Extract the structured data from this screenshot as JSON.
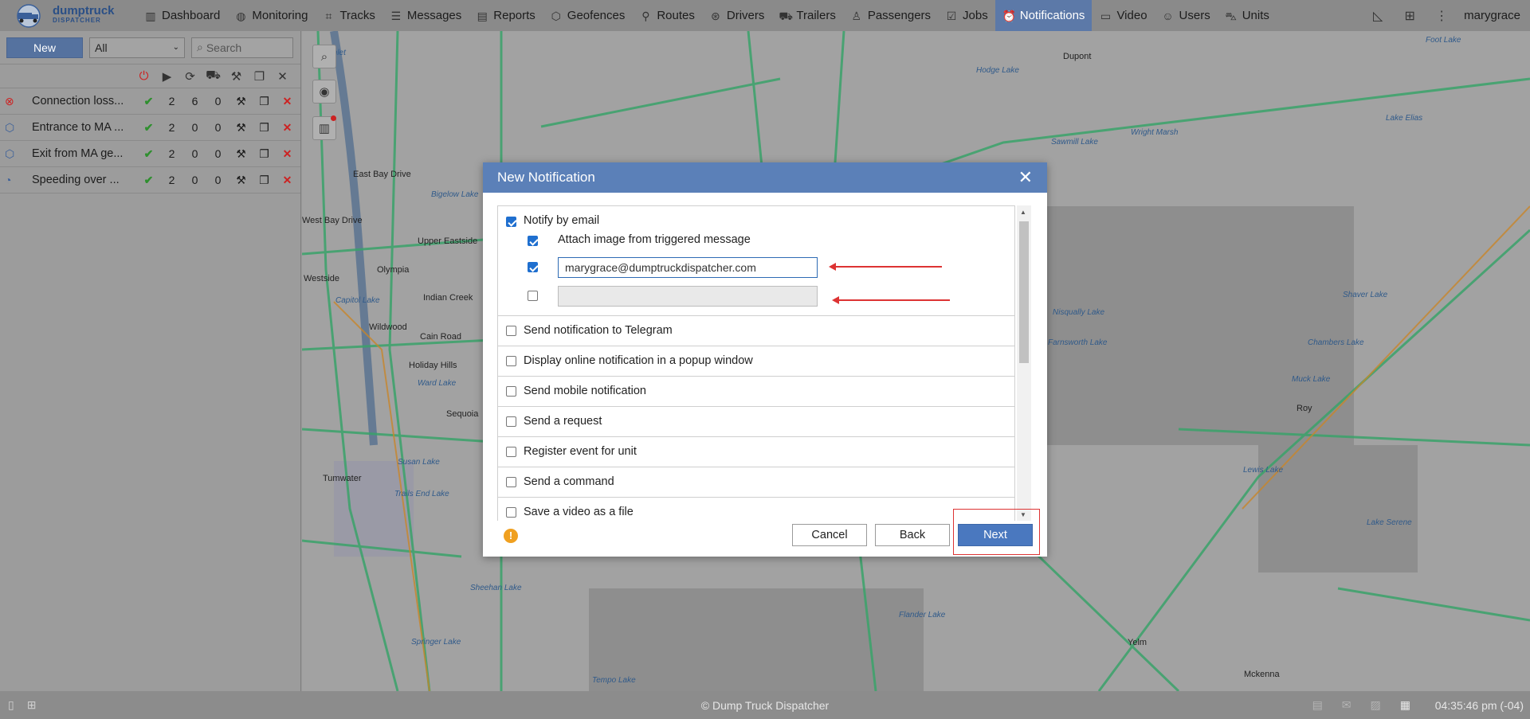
{
  "topbar": {
    "brand_line1": "dumptruck",
    "brand_line2": "DISPATCHER",
    "nav": [
      {
        "label": "Dashboard",
        "icon": "bar-chart-icon"
      },
      {
        "label": "Monitoring",
        "icon": "globe-icon"
      },
      {
        "label": "Tracks",
        "icon": "tracks-icon"
      },
      {
        "label": "Messages",
        "icon": "messages-icon"
      },
      {
        "label": "Reports",
        "icon": "reports-icon"
      },
      {
        "label": "Geofences",
        "icon": "geofence-icon"
      },
      {
        "label": "Routes",
        "icon": "routes-icon"
      },
      {
        "label": "Drivers",
        "icon": "steering-wheel-icon"
      },
      {
        "label": "Trailers",
        "icon": "trailer-icon"
      },
      {
        "label": "Passengers",
        "icon": "passenger-icon"
      },
      {
        "label": "Jobs",
        "icon": "jobs-icon"
      },
      {
        "label": "Notifications",
        "icon": "alarm-clock-icon",
        "active": true
      },
      {
        "label": "Video",
        "icon": "video-icon"
      },
      {
        "label": "Users",
        "icon": "user-icon"
      },
      {
        "label": "Units",
        "icon": "truck-icon"
      }
    ],
    "username": "marygrace"
  },
  "leftpanel": {
    "new_label": "New",
    "filter_value": "All",
    "search_placeholder": "Search",
    "rows": [
      {
        "name": "Connection loss...",
        "count1": "2",
        "count2": "6",
        "count3": "0"
      },
      {
        "name": "Entrance to MA ...",
        "count1": "2",
        "count2": "0",
        "count3": "0"
      },
      {
        "name": "Exit from MA ge...",
        "count1": "2",
        "count2": "0",
        "count3": "0"
      },
      {
        "name": "Speeding over ...",
        "count1": "2",
        "count2": "0",
        "count3": "0"
      }
    ]
  },
  "map": {
    "labels": [
      "Inlet",
      "Dupont",
      "Hodge Lake",
      "Foot Lake",
      "Sawmill Lake",
      "Wright Marsh",
      "Lake Elias",
      "East Bay Drive",
      "Bigelow Lake",
      "West Bay Drive",
      "Olympia",
      "Upper Eastside",
      "Westside",
      "Indian Creek",
      "Capitol Lake",
      "Wildwood",
      "Cain Road",
      "Holiday Hills",
      "Ward Lake",
      "Sequoia",
      "Susan Lake",
      "Tumwater",
      "Trails End Lake",
      "Nisqually Lake",
      "Farnsworth Lake",
      "Shaver Lake",
      "Chambers Lake",
      "Muck Lake",
      "Roy",
      "Lewis Lake",
      "Lake Serene",
      "Sheehan Lake",
      "Flander Lake",
      "Springer Lake",
      "Tempo Lake",
      "Yelm",
      "Mckenna"
    ]
  },
  "modal": {
    "title": "New Notification",
    "notify_email_label": "Notify by email",
    "attach_image_label": "Attach image from triggered message",
    "email_value": "marygrace@dumptruckdispatcher.com",
    "options": [
      "Send notification to Telegram",
      "Display online notification in a popup window",
      "Send mobile notification",
      "Send a request",
      "Register event for unit",
      "Send a command",
      "Save a video as a file"
    ],
    "cancel_label": "Cancel",
    "back_label": "Back",
    "next_label": "Next"
  },
  "bottombar": {
    "copyright": "© Dump Truck Dispatcher",
    "time": "04:35:46 pm (-04)"
  }
}
